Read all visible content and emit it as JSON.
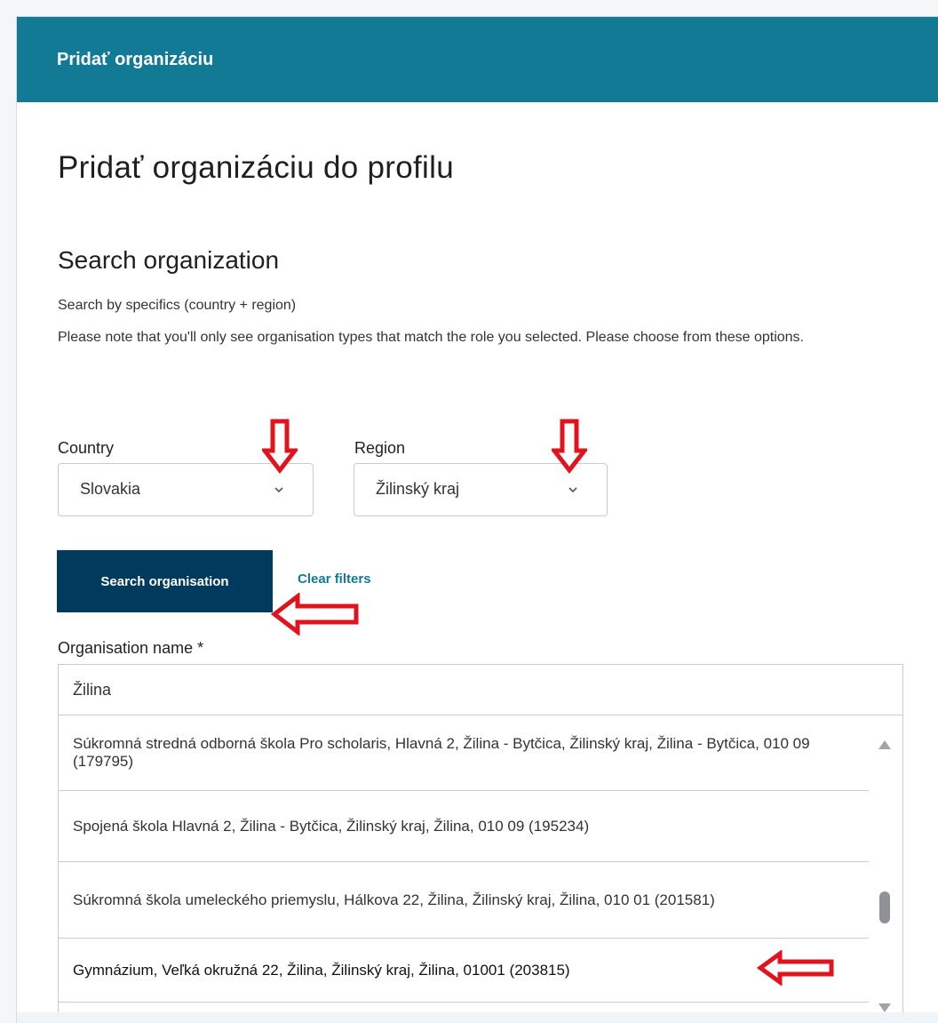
{
  "header": {
    "title": "Pridať organizáciu"
  },
  "page": {
    "title": "Pridať organizáciu do profilu"
  },
  "search": {
    "section_title": "Search organization",
    "helper_1": "Search by specifics (country + region)",
    "helper_2": "Please note that you'll only see organisation types that match the role you selected. Please choose from these options."
  },
  "country": {
    "label": "Country",
    "value": "Slovakia"
  },
  "region": {
    "label": "Region",
    "value": "Žilinský kraj"
  },
  "buttons": {
    "search_label": "Search organisation",
    "clear_label": "Clear filters"
  },
  "organisation": {
    "label": "Organisation name *",
    "value": "Žilina",
    "results": [
      "Súkromná stredná odborná škola Pro scholaris, Hlavná 2, Žilina - Bytčica, Žilinský kraj, Žilina - Bytčica, 010 09 (179795)",
      "Spojená škola Hlavná 2, Žilina - Bytčica, Žilinský kraj, Žilina, 010 09 (195234)",
      "Súkromná škola umeleckého priemyslu, Hálkova 22, Žilina, Žilinský kraj, Žilina, 010 01 (201581)",
      "Gymnázium, Veľká okružná 22, Žilina, Žilinský kraj, Žilina, 01001 (203815)"
    ]
  },
  "colors": {
    "header_bg": "#137a96",
    "primary_button": "#003a5c",
    "link": "#137a96",
    "annotation_arrow": "#e0141e"
  },
  "icons": {
    "select_chevron": "chevron-down-icon",
    "annotation": "red-arrow-icon",
    "scroll_up": "scroll-up-icon",
    "scroll_down": "scroll-down-icon"
  }
}
